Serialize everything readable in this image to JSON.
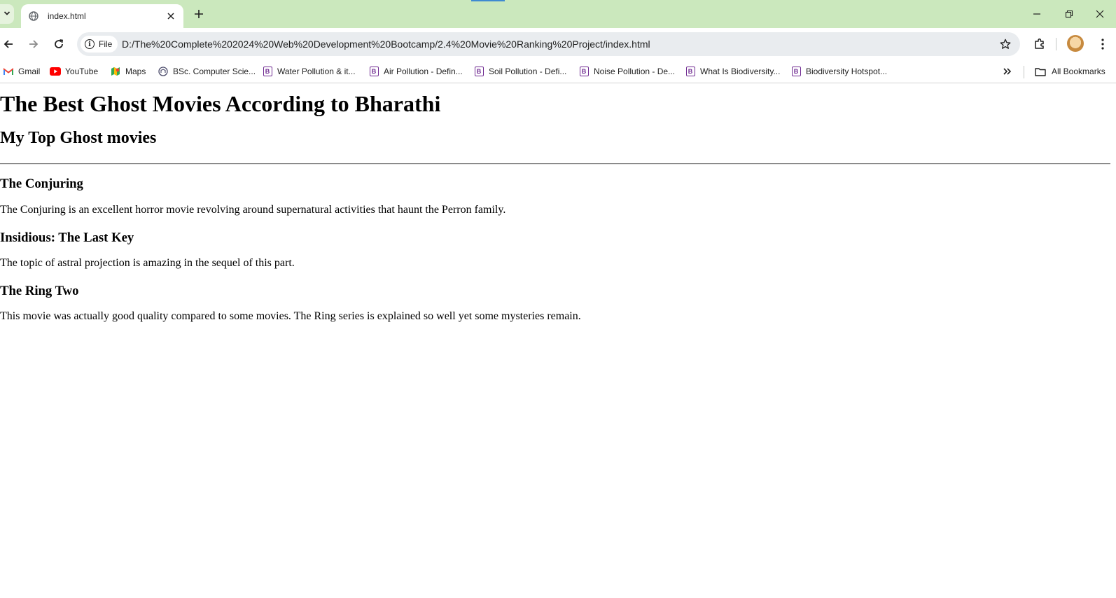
{
  "browser": {
    "tab": {
      "title": "index.html"
    },
    "address_bar": {
      "chip_label": "File",
      "url": "D:/The%20Complete%202024%20Web%20Development%20Bootcamp/2.4%20Movie%20Ranking%20Project/index.html"
    },
    "bookmarks": [
      {
        "label": "Gmail",
        "icon": "gmail-icon"
      },
      {
        "label": "YouTube",
        "icon": "youtube-icon"
      },
      {
        "label": "Maps",
        "icon": "maps-icon"
      },
      {
        "label": "BSc. Computer Scie...",
        "icon": "university-icon"
      },
      {
        "label": "Water Pollution & it...",
        "icon": "bookmark-page-icon"
      },
      {
        "label": "Air Pollution - Defin...",
        "icon": "bookmark-page-icon"
      },
      {
        "label": "Soil Pollution - Defi...",
        "icon": "bookmark-page-icon"
      },
      {
        "label": "Noise Pollution - De...",
        "icon": "bookmark-page-icon"
      },
      {
        "label": "What Is Biodiversity...",
        "icon": "bookmark-page-icon"
      },
      {
        "label": "Biodiversity Hotspot...",
        "icon": "bookmark-page-icon"
      }
    ],
    "all_bookmarks_label": "All Bookmarks"
  },
  "page": {
    "title": "The Best Ghost Movies According to Bharathi",
    "subtitle": "My Top Ghost movies",
    "movies": [
      {
        "title": "The Conjuring",
        "description": "The Conjuring is an excellent horror movie revolving around supernatural activities that haunt the Perron family."
      },
      {
        "title": "Insidious: The Last Key",
        "description": "The topic of astral projection is amazing in the sequel of this part."
      },
      {
        "title": "The Ring Two",
        "description": "This movie was actually good quality compared to some movies. The Ring series is explained so well yet some mysteries remain."
      }
    ]
  },
  "colors": {
    "titlebar": "#cbe8bd",
    "omnibox": "#e9ecef",
    "bookmark_icon": "#6f2a91"
  }
}
